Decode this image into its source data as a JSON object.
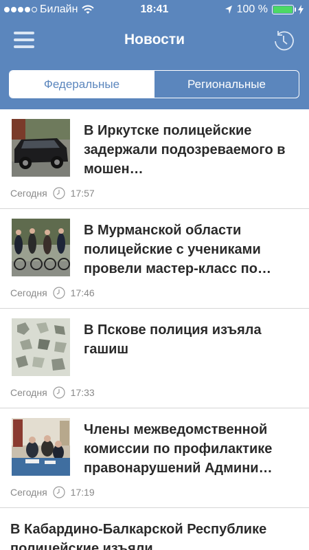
{
  "status_bar": {
    "carrier": "Билайн",
    "time": "18:41",
    "battery": "100 %",
    "battery_level": 1.0
  },
  "nav": {
    "title": "Новости",
    "menu_icon": "hamburger-menu-icon",
    "history_icon": "history-clock-icon"
  },
  "tabs": [
    {
      "label": "Федеральные",
      "selected": true
    },
    {
      "label": "Региональные",
      "selected": false
    }
  ],
  "colors": {
    "header": "#5b86bd",
    "battery": "#4cd964",
    "title_text": "#2a2a2a",
    "meta_text": "#888888"
  },
  "news": [
    {
      "title": "В Иркутске полицейские задержали подозреваемого в мошен…",
      "date": "Сегодня",
      "time": "17:57",
      "thumb": "black-suv-photo"
    },
    {
      "title": "В Мурманской области полицейские с учениками провели мастер-класс по…",
      "date": "Сегодня",
      "time": "17:46",
      "thumb": "cyclists-photo"
    },
    {
      "title": "В Пскове полиция изъяла гашиш",
      "date": "Сегодня",
      "time": "17:33",
      "thumb": "crystals-photo"
    },
    {
      "title": "Члены межведомственной комиссии по профилактике правонарушений Админи…",
      "date": "Сегодня",
      "time": "17:19",
      "thumb": "meeting-photo"
    },
    {
      "title": "В Кабардино-Балкарской Республике полицейские изъяли"
    }
  ]
}
